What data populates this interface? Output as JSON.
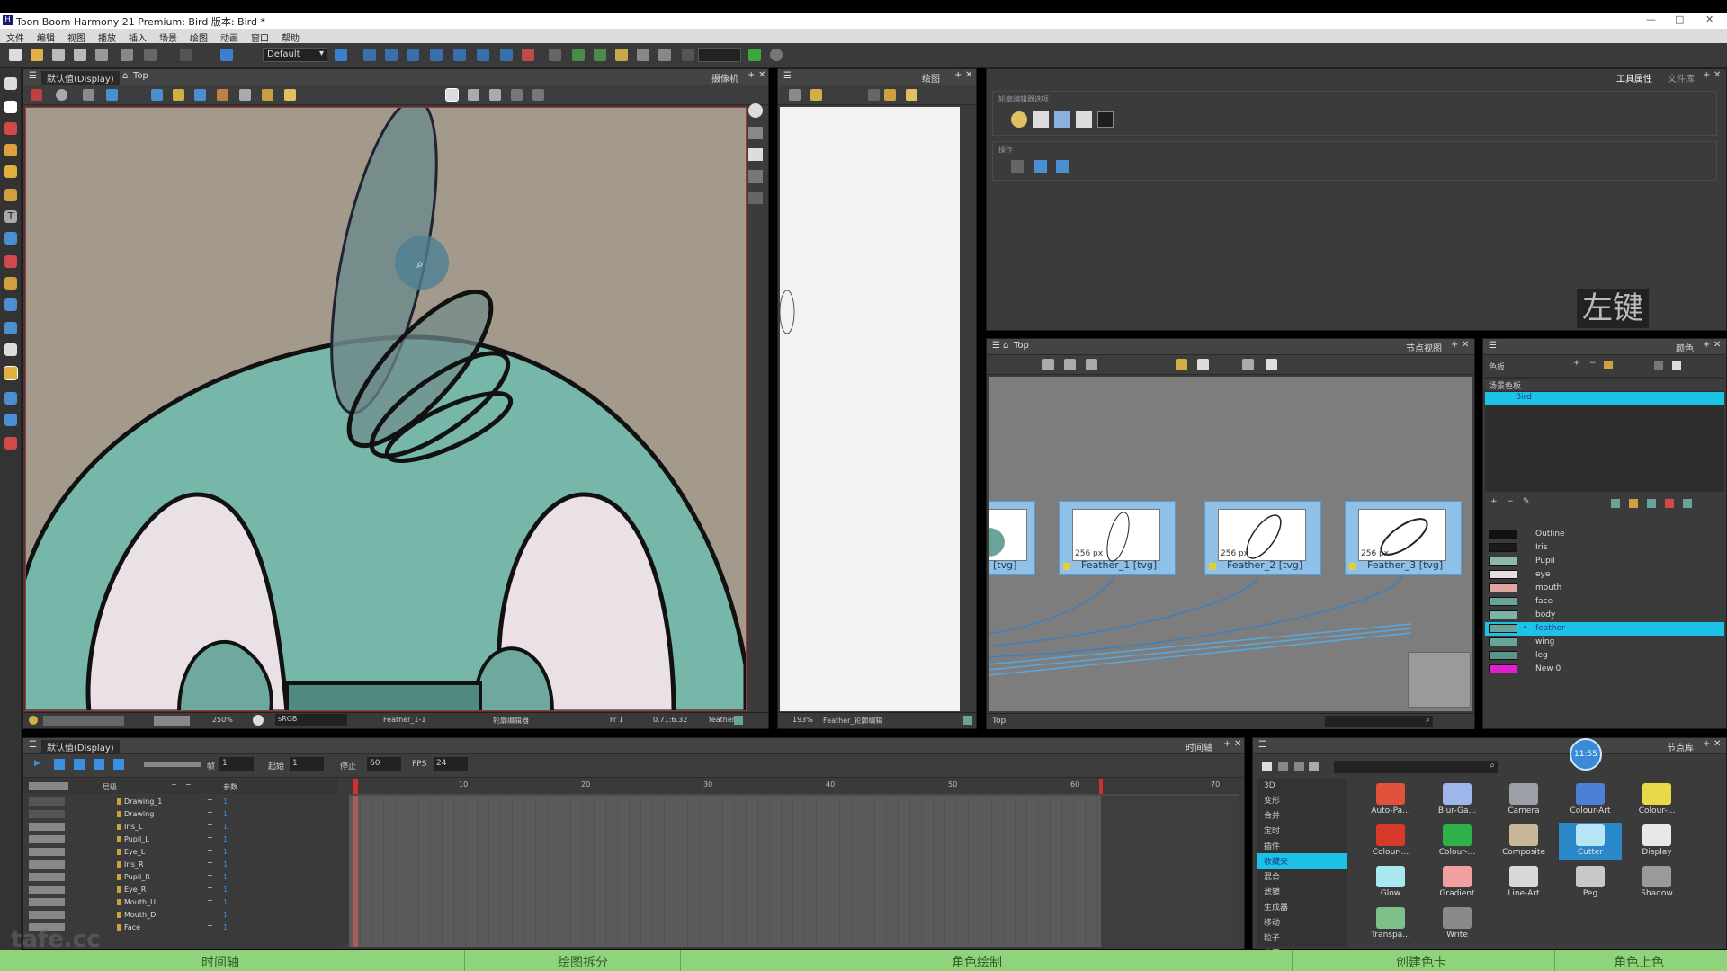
{
  "window": {
    "title": "Toon Boom Harmony 21 Premium: Bird 版本: Bird *",
    "controls": [
      "—",
      "□",
      "✕"
    ]
  },
  "menu": [
    "文件",
    "编辑",
    "视图",
    "播放",
    "插入",
    "场景",
    "绘图",
    "动画",
    "窗口",
    "帮助"
  ],
  "toolbar": {
    "workspace": "Default"
  },
  "camera_view": {
    "view_label": "默认值(Display)",
    "breadcrumb": "Top",
    "tab": "摄像机",
    "zoom": "250%",
    "color_space": "sRGB",
    "drawing_name": "Feather_1-1",
    "status_label": "轮廓编辑器",
    "frame": "Fr 1",
    "coords": "0.71:6.32",
    "layer_label": "feather"
  },
  "drawing_view": {
    "tab": "绘图",
    "zoom": "193%",
    "drawing_name": "Feather_轮廓编辑"
  },
  "tool_props": {
    "tab_active": "工具属性",
    "tab_other": "文件库",
    "section1": "轮廓编辑器选项",
    "section2": "操作"
  },
  "watermark_key": "左键",
  "node_view": {
    "breadcrumb": "Top",
    "tab": "节点视图",
    "footer": "Top",
    "nodes": [
      {
        "label": "Feather_1 [tvg]",
        "size": "256 px"
      },
      {
        "label": "Feather_2 [tvg]",
        "size": "256 px"
      },
      {
        "label": "Feather_3 [tvg]",
        "size": "256 px"
      }
    ],
    "partial_node_label": "y [tvg]"
  },
  "colour_view": {
    "tab": "颜色",
    "palette_section": "色板",
    "scene_palette": "场景色板",
    "palette_name": "Bird",
    "swatches": [
      {
        "name": "Outline",
        "color": "#111111"
      },
      {
        "name": "Iris",
        "color": "#1a1a1a"
      },
      {
        "name": "Pupil",
        "color": "#8ab8ac"
      },
      {
        "name": "eye",
        "color": "#e8dde3"
      },
      {
        "name": "mouth",
        "color": "#e2a6a0"
      },
      {
        "name": "face",
        "color": "#6aa39a"
      },
      {
        "name": "body",
        "color": "#79b3a9"
      },
      {
        "name": "feather",
        "color": "#6aa39a"
      },
      {
        "name": "wing",
        "color": "#6aa39a"
      },
      {
        "name": "leg",
        "color": "#5a958b"
      },
      {
        "name": "New 0",
        "color": "#e21ed1"
      }
    ]
  },
  "timeline": {
    "view_label": "默认值(Display)",
    "tab": "时间轴",
    "frame_label": "帧",
    "frame_value": "1",
    "start_label": "起始",
    "start_value": "1",
    "stop_label": "停止",
    "stop_value": "60",
    "fps_label": "FPS",
    "fps_value": "24",
    "layers_header": "层级",
    "params_header": "参数",
    "ruler": [
      "10",
      "20",
      "30",
      "40",
      "50",
      "60",
      "70"
    ],
    "layers": [
      "Drawing_1",
      "Drawing",
      "Iris_L",
      "Pupil_L",
      "Eye_L",
      "Iris_R",
      "Pupil_R",
      "Eye_R",
      "Mouth_U",
      "Mouth_D",
      "Face"
    ]
  },
  "node_library": {
    "tab": "节点库",
    "time_badge": "11:55",
    "categories": [
      "3D",
      "变形",
      "合并",
      "定时",
      "插件",
      "收藏夹",
      "混合",
      "滤镜",
      "生成器",
      "移动",
      "粒子",
      "约束"
    ],
    "selected_category": "收藏夹",
    "modules": [
      {
        "name": "Auto-Pa...",
        "color": "#e0523c"
      },
      {
        "name": "Blur-Ga...",
        "color": "#9fb6ea"
      },
      {
        "name": "Camera",
        "color": "#9aa0a5"
      },
      {
        "name": "Colour-Art",
        "color": "#4d7fd6"
      },
      {
        "name": "Colour-...",
        "color": "#e8d84a"
      },
      {
        "name": "Colour-...",
        "color": "#d83a2a"
      },
      {
        "name": "Colour-...",
        "color": "#2db24a"
      },
      {
        "name": "Composite",
        "color": "#c9b79a"
      },
      {
        "name": "Cutter",
        "color": "#b8e5f5"
      },
      {
        "name": "Display",
        "color": "#e8e8e8"
      },
      {
        "name": "Glow",
        "color": "#a9e8f0"
      },
      {
        "name": "Gradient",
        "color": "#f0a0a0"
      },
      {
        "name": "Line-Art",
        "color": "#d8d8d8"
      },
      {
        "name": "Peg",
        "color": "#c8c8c8"
      },
      {
        "name": "Shadow",
        "color": "#9a9a9a"
      },
      {
        "name": "Transpa...",
        "color": "#7fc08a"
      },
      {
        "name": "Write",
        "color": "#8a8a8a"
      }
    ]
  },
  "logo": "tafe.cc",
  "bottom_tabs": [
    "时间轴",
    "绘图拆分",
    "角色绘制",
    "创建色卡",
    "角色上色"
  ]
}
